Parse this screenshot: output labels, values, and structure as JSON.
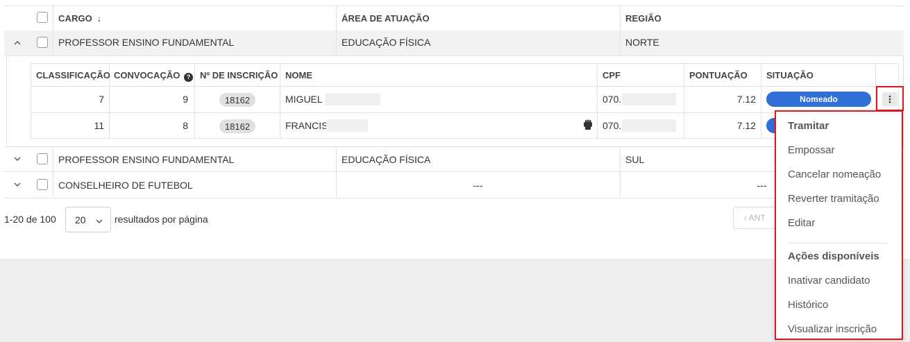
{
  "table": {
    "headers": {
      "cargo": "CARGO",
      "area": "ÁREA DE ATUAÇÃO",
      "regiao": "REGIÃO"
    },
    "rows": [
      {
        "cargo": "PROFESSOR ENSINO FUNDAMENTAL",
        "area": "EDUCAÇÃO FÍSICA",
        "regiao": "NORTE"
      },
      {
        "cargo": "PROFESSOR ENSINO FUNDAMENTAL",
        "area": "EDUCAÇÃO FÍSICA",
        "regiao": "SUL"
      },
      {
        "cargo": "CONSELHEIRO DE FUTEBOL",
        "area": "---",
        "regiao": "---"
      }
    ]
  },
  "subtable": {
    "headers": {
      "classificacao": "CLASSIFICAÇÃO",
      "convocacao": "CONVOCAÇÃO",
      "inscricao": "Nº DE INSCRIÇÃO",
      "nome": "NOME",
      "cpf": "CPF",
      "pontuacao": "PONTUAÇÃO",
      "situacao": "SITUAÇÃO"
    },
    "rows": [
      {
        "classificacao": "7",
        "convocacao": "9",
        "inscricao": "18162",
        "nome": "MIGUEL",
        "cpf": "070.",
        "pontuacao": "7.12",
        "situacao": "Nomeado"
      },
      {
        "classificacao": "11",
        "convocacao": "8",
        "inscricao": "18162",
        "nome": "FRANCIS",
        "cpf": "070.",
        "pontuacao": "7.12",
        "situacao": ""
      }
    ]
  },
  "pagination": {
    "range": "1-20 de 100",
    "per_page": "20",
    "per_page_label": "resultados por página",
    "prev_label": "‹ ANT"
  },
  "menu": {
    "section1_title": "Tramitar",
    "section1_items": [
      "Empossar",
      "Cancelar nomeação",
      "Reverter tramitação",
      "Editar"
    ],
    "section2_title": "Ações disponíveis",
    "section2_items": [
      "Inativar candidato",
      "Histórico",
      "Visualizar inscrição"
    ]
  },
  "colors": {
    "accent": "#2f6fd6",
    "highlight": "#e0161e"
  },
  "icons": {
    "sort": "arrow-down-icon",
    "help": "question-circle-icon",
    "flag": "raised-fist-icon",
    "kebab": "more-vertical-icon"
  }
}
